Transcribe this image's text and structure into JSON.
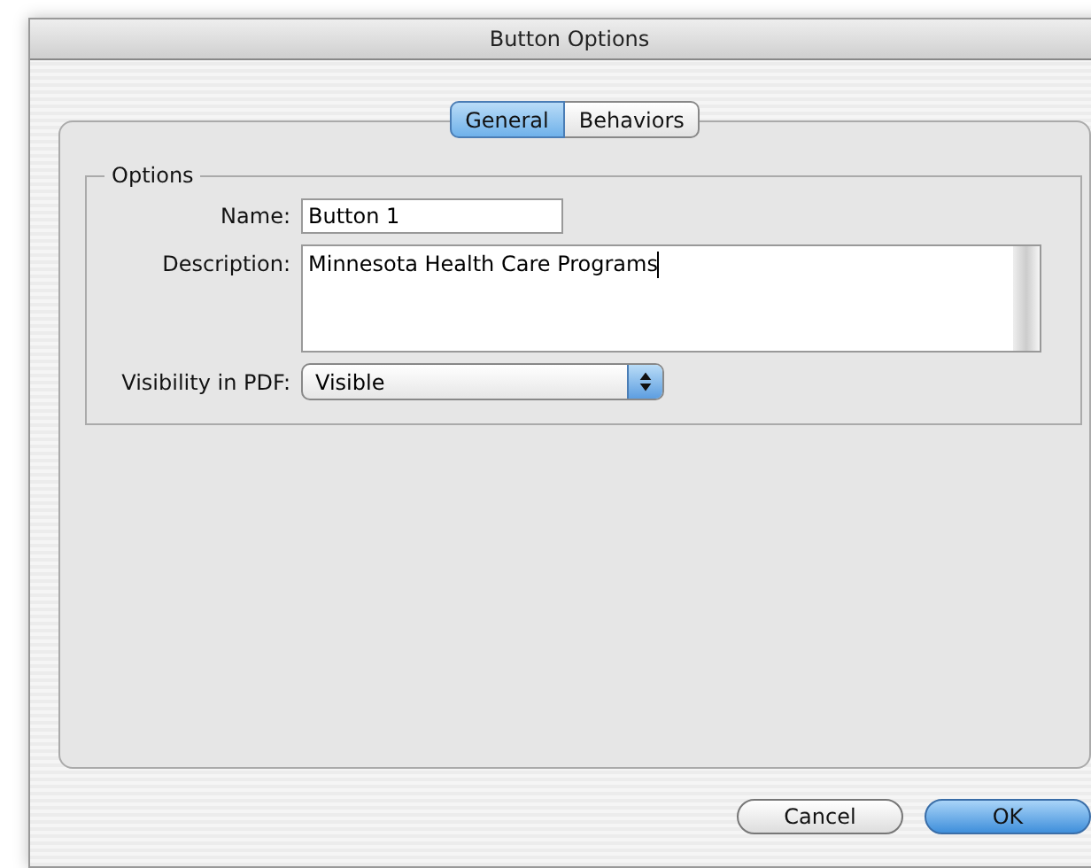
{
  "window": {
    "title": "Button Options"
  },
  "tabs": [
    {
      "label": "General",
      "selected": true
    },
    {
      "label": "Behaviors",
      "selected": false
    }
  ],
  "options": {
    "title": "Options",
    "name": {
      "label": "Name:",
      "value": "Button 1"
    },
    "description": {
      "label": "Description:",
      "value": "Minnesota Health Care Programs"
    },
    "visibility": {
      "label": "Visibility in PDF:",
      "value": "Visible"
    }
  },
  "buttons": [
    {
      "label": "Cancel",
      "kind": "secondary"
    },
    {
      "label": "OK",
      "kind": "default"
    }
  ]
}
